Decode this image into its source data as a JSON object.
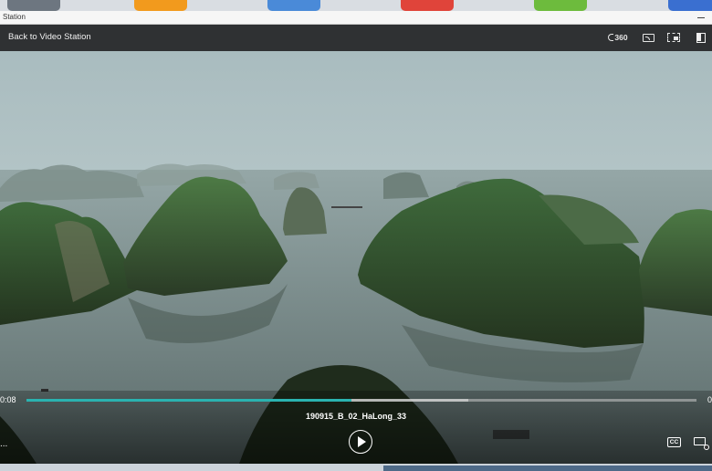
{
  "window": {
    "title": "Station"
  },
  "desktop_icons": [
    {
      "name": "settings",
      "color": "#6d7680"
    },
    {
      "name": "file-station",
      "color": "#f29a1d"
    },
    {
      "name": "storage",
      "color": "#4a8ad8"
    },
    {
      "name": "app-center",
      "color": "#e0443a"
    },
    {
      "name": "help",
      "color": "#6dbb3d"
    },
    {
      "name": "desktop",
      "color": "#3a6fd0"
    }
  ],
  "topbar": {
    "back_label": "Back to Video Station",
    "icons": [
      "360-view-icon",
      "cast-icon",
      "picture-in-picture-icon",
      "fullscreen-icon"
    ],
    "label_360": "360"
  },
  "player": {
    "filename": "190915_B_02_HaLong_33",
    "current_time": "0:08",
    "end_time": "0",
    "progress": 0.485,
    "buffered": 0.66,
    "accent_color": "#2ab3b0",
    "cc_label": "CC",
    "more_label": "..."
  }
}
